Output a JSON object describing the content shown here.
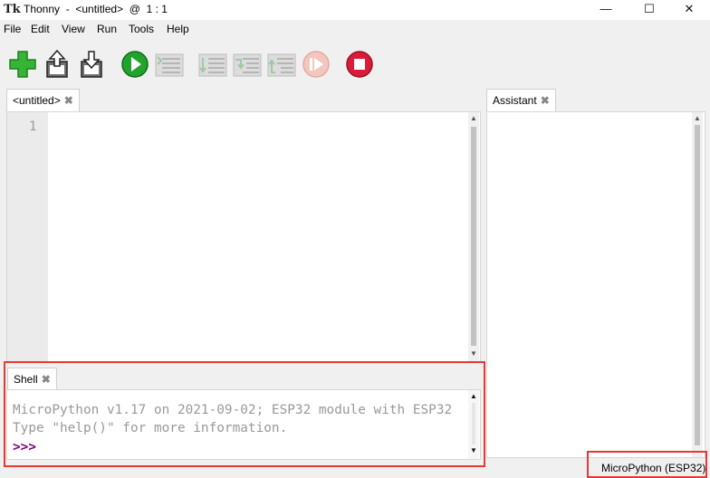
{
  "window": {
    "icon_text": "Tk",
    "title": "Thonny  -  <untitled>  @  1 : 1",
    "minimize_glyph": "—",
    "maximize_glyph": "☐",
    "close_glyph": "✕"
  },
  "menu": [
    {
      "label": "File"
    },
    {
      "label": "Edit"
    },
    {
      "label": "View"
    },
    {
      "label": "Run"
    },
    {
      "label": "Tools"
    },
    {
      "label": "Help"
    }
  ],
  "toolbar": [
    {
      "icon": "new-file-icon",
      "enabled": true
    },
    {
      "icon": "open-file-icon",
      "enabled": true
    },
    {
      "icon": "save-file-icon",
      "enabled": true
    },
    {
      "icon": "run-icon",
      "enabled": true
    },
    {
      "icon": "debug-icon",
      "enabled": false
    },
    {
      "icon": "step-over-icon",
      "enabled": false
    },
    {
      "icon": "step-into-icon",
      "enabled": false
    },
    {
      "icon": "step-out-icon",
      "enabled": false
    },
    {
      "icon": "resume-icon",
      "enabled": false
    },
    {
      "icon": "stop-icon",
      "enabled": true
    }
  ],
  "editor": {
    "tab_label": "<untitled>",
    "close_glyph": "✖",
    "line_number": "1"
  },
  "shell": {
    "tab_label": "Shell",
    "close_glyph": "✖",
    "lines": [
      "MicroPython v1.17 on 2021-09-02; ESP32 module with ESP32",
      "Type \"help()\" for more information."
    ],
    "prompt": ">>>"
  },
  "assistant": {
    "tab_label": "Assistant",
    "close_glyph": "✖"
  },
  "status": {
    "interpreter": "MicroPython (ESP32)"
  },
  "colors": {
    "highlight_box": "#e53935",
    "run_green": "#22a32c",
    "stop_red": "#d91c3a",
    "prompt_purple": "#800080"
  }
}
